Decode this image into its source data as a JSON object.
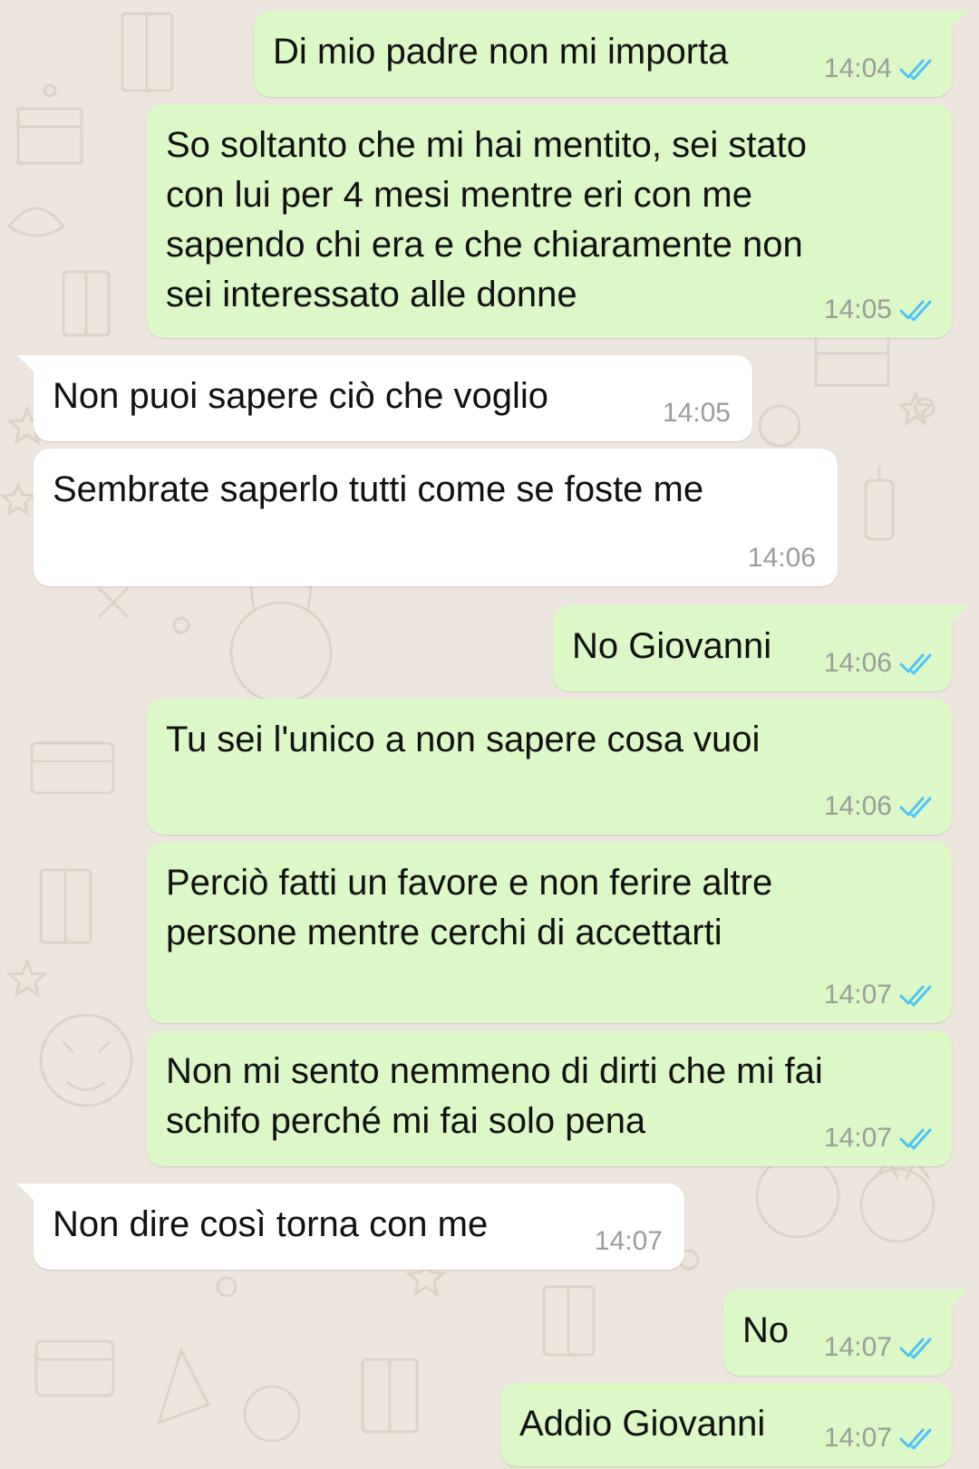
{
  "colors": {
    "background": "#ECE5DD",
    "outgoing_bubble": "#DCF8C6",
    "incoming_bubble": "#FFFFFF",
    "read_ticks": "#4FC3F7",
    "timestamp": "#9A9E99"
  },
  "icons": {
    "read_receipt": "double-check-icon"
  },
  "messages": [
    {
      "direction": "out",
      "text": "Di mio padre non mi importa",
      "time": "14:04",
      "status": "read"
    },
    {
      "direction": "out",
      "text": "So soltanto che mi hai mentito, sei stato\ncon lui per 4 mesi mentre eri con me\nsapendo chi era e che chiaramente non\nsei interessato alle donne",
      "time": "14:05",
      "status": "read"
    },
    {
      "direction": "in",
      "text": "Non puoi sapere ciò che voglio",
      "time": "14:05"
    },
    {
      "direction": "in",
      "text": "Sembrate saperlo tutti come se foste me",
      "time": "14:06"
    },
    {
      "direction": "out",
      "text": "No Giovanni",
      "time": "14:06",
      "status": "read"
    },
    {
      "direction": "out",
      "text": "Tu sei l'unico a non sapere cosa vuoi",
      "time": "14:06",
      "status": "read"
    },
    {
      "direction": "out",
      "text": "Perciò fatti un favore e non ferire altre\npersone mentre cerchi di accettarti",
      "time": "14:07",
      "status": "read"
    },
    {
      "direction": "out",
      "text": "Non mi sento nemmeno di dirti che mi fai\nschifo perché mi fai solo pena",
      "time": "14:07",
      "status": "read"
    },
    {
      "direction": "in",
      "text": "Non dire così torna con me",
      "time": "14:07"
    },
    {
      "direction": "out",
      "text": "No",
      "time": "14:07",
      "status": "read"
    },
    {
      "direction": "out",
      "text": "Addio Giovanni",
      "time": "14:07",
      "status": "read"
    }
  ]
}
